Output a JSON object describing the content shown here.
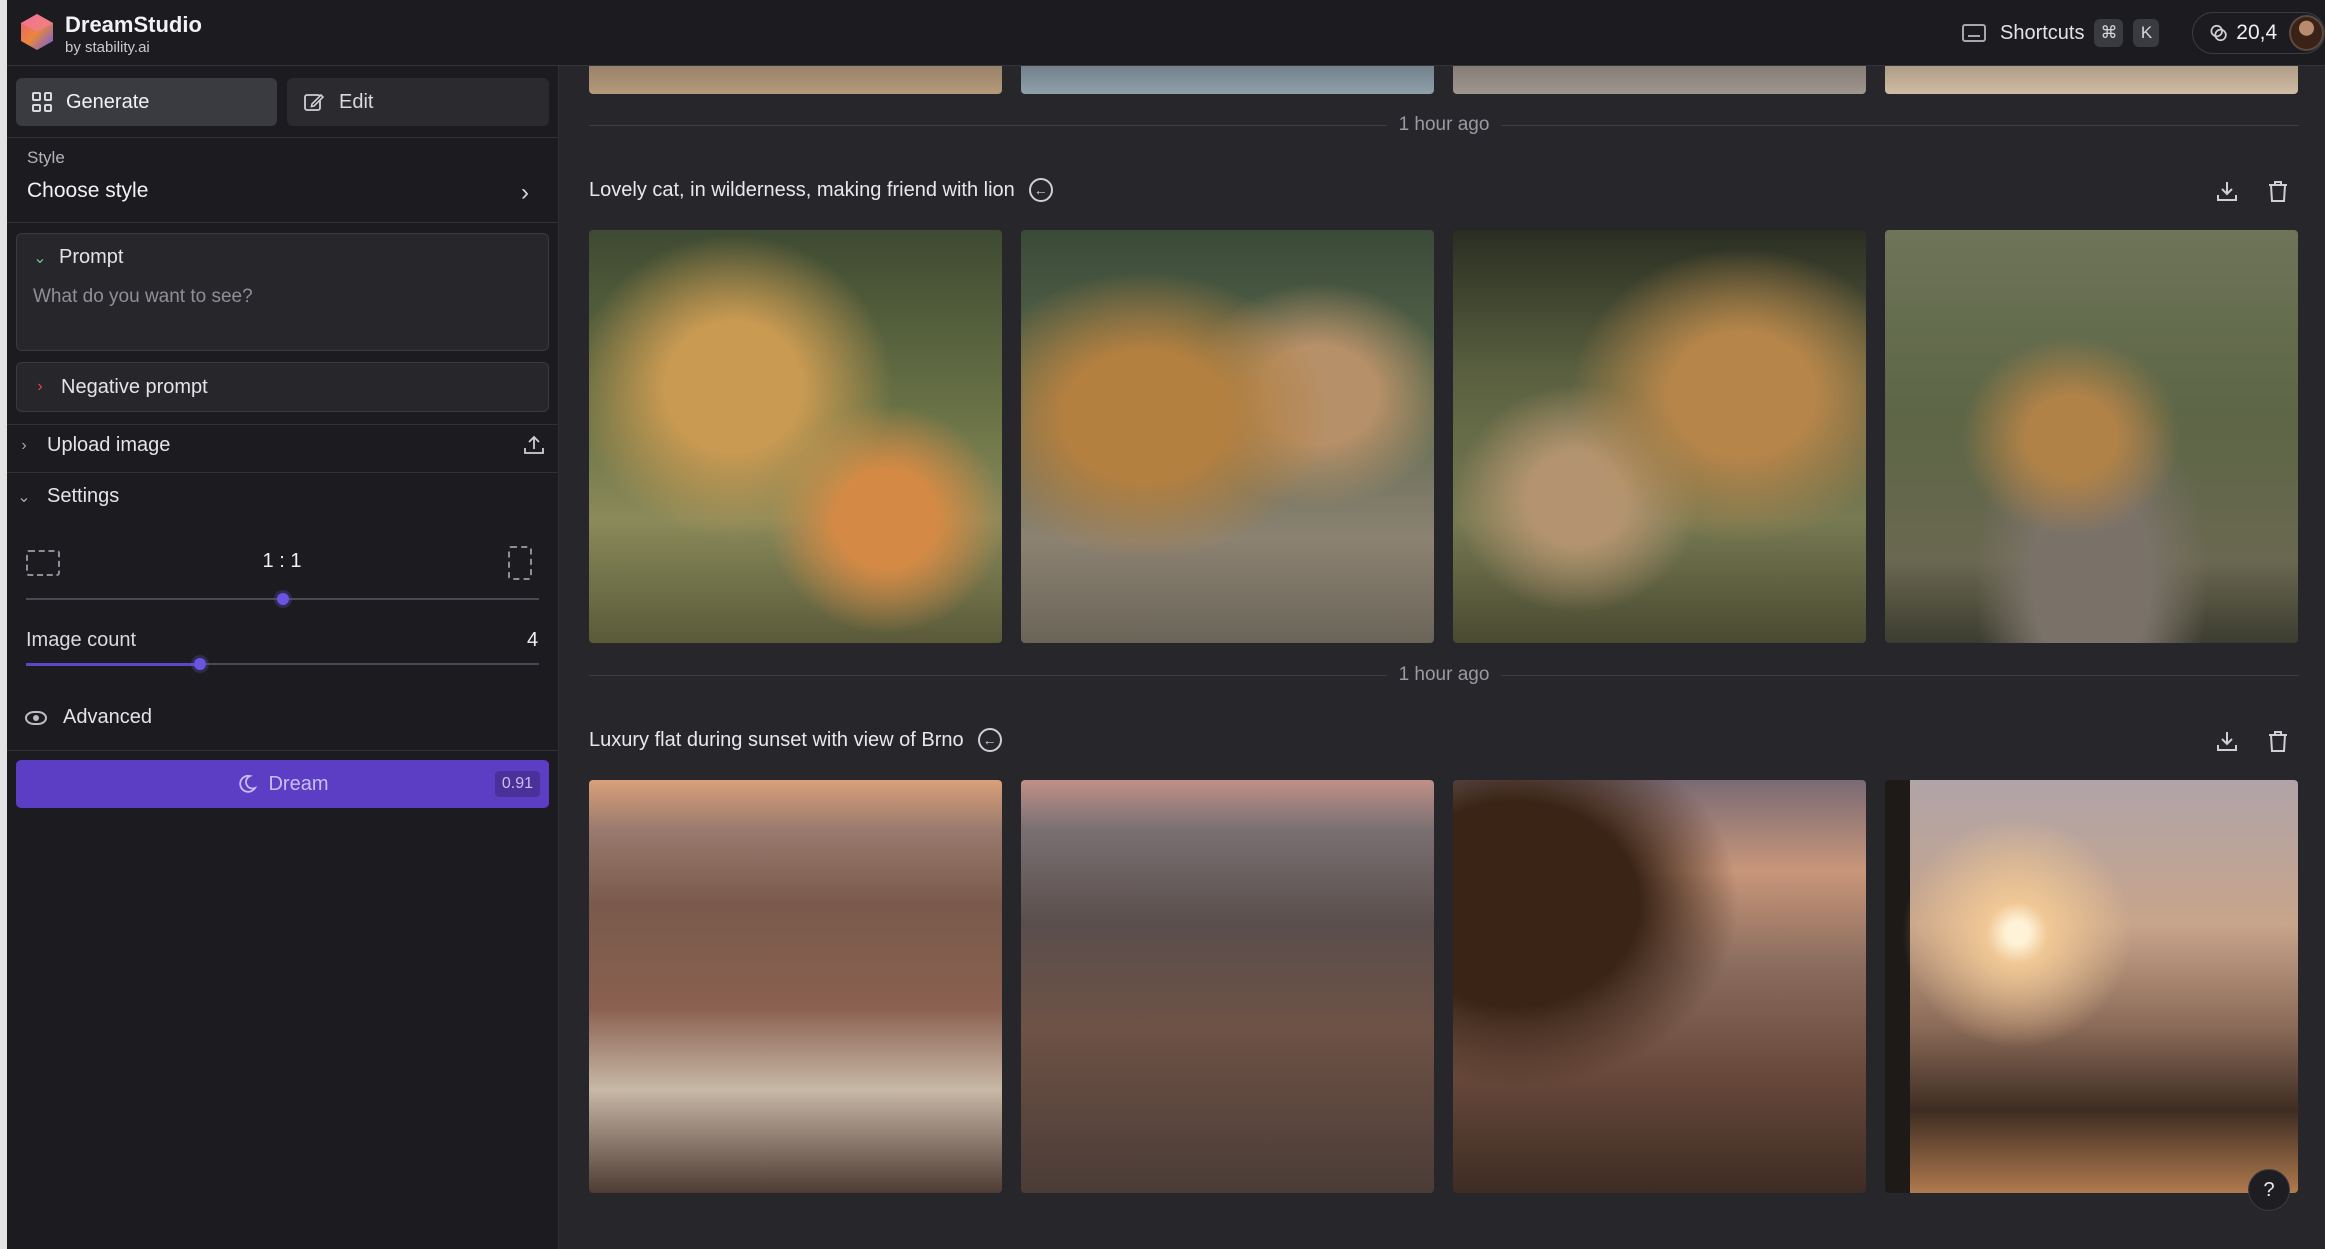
{
  "app": {
    "name": "DreamStudio",
    "byline": "by stability.ai"
  },
  "header": {
    "shortcuts_label": "Shortcuts",
    "shortcut_keys": [
      "⌘",
      "K"
    ],
    "credits": "20,4"
  },
  "sidebar": {
    "tabs": {
      "generate": "Generate",
      "edit": "Edit"
    },
    "style": {
      "label": "Style",
      "value": "Choose style"
    },
    "prompt": {
      "label": "Prompt",
      "placeholder": "What do you want to see?"
    },
    "negative_prompt": {
      "label": "Negative prompt"
    },
    "upload_image": {
      "label": "Upload image"
    },
    "settings": {
      "label": "Settings",
      "aspect_ratio": "1 : 1",
      "aspect_ratio_position": 0.5,
      "image_count_label": "Image count",
      "image_count": "4",
      "image_count_position": 0.34
    },
    "advanced": {
      "label": "Advanced"
    },
    "dream": {
      "label": "Dream",
      "cost": "0.91"
    }
  },
  "main": {
    "groups": [
      {
        "time": "1 hour ago",
        "prompt": "Lovely cat, in wilderness, making friend with lion",
        "images": 4
      },
      {
        "time": "1 hour ago",
        "prompt": "Luxury flat during sunset with view of Brno",
        "images": 4
      }
    ]
  },
  "help_label": "?",
  "colors": {
    "accent": "#5b3ec4",
    "background": "#26262b",
    "sidebar": "#1c1c20"
  }
}
